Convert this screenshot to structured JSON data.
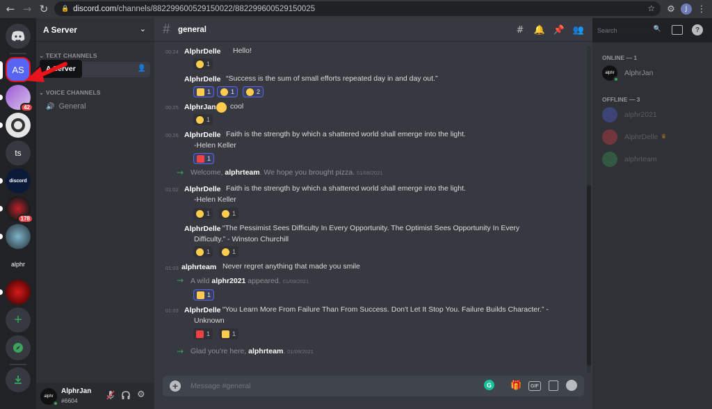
{
  "browser": {
    "url_host": "discord.com",
    "url_path": "/channels/882299600529150022/882299600529150025",
    "profile_initial": "J"
  },
  "rail": {
    "servers": [
      {
        "name": "home",
        "label": ""
      },
      {
        "name": "a-server",
        "label": "AS"
      },
      {
        "name": "server-2",
        "label": "",
        "badge": "42"
      },
      {
        "name": "server-3",
        "label": ""
      },
      {
        "name": "server-ts",
        "label": "ts"
      },
      {
        "name": "server-discord-bio",
        "label": "discord"
      },
      {
        "name": "server-6",
        "label": "",
        "badge": "178"
      },
      {
        "name": "server-7",
        "label": ""
      },
      {
        "name": "server-alphr",
        "label": "alphr"
      },
      {
        "name": "server-9",
        "label": ""
      }
    ],
    "add_label": "+",
    "tooltip": "A Server"
  },
  "sidebar": {
    "server_name": "A Server",
    "text_category": "TEXT CHANNELS",
    "voice_category": "VOICE CHANNELS",
    "voice_channel": "General",
    "user": {
      "name": "AlphrJan",
      "tag": "#6604",
      "avatar_text": "alphr"
    }
  },
  "topbar": {
    "channel": "general",
    "search_placeholder": "Search"
  },
  "messages": [
    {
      "time": "00:24",
      "author": "AlphrDelle",
      "text": "Hello!",
      "reactions": [
        {
          "emoji": "heart-eyes",
          "count": "1"
        }
      ]
    },
    {
      "author": "AlphrDelle",
      "text": "“Success is the sum of small efforts repeated day in and day out.”",
      "reactions": [
        {
          "emoji": "thumbs-up",
          "count": "1"
        },
        {
          "emoji": "grin",
          "count": "1"
        },
        {
          "emoji": "heart-eyes",
          "count": "2"
        }
      ]
    },
    {
      "time": "00:25",
      "author": "AlphrJan",
      "text": "cool",
      "reactions": [
        {
          "emoji": "smile",
          "count": "1"
        }
      ]
    },
    {
      "time": "00:26",
      "author": "AlphrDelle",
      "text": "Faith is the strength by which a shattered world shall emerge into the light.",
      "text2": "-Helen Keller",
      "reactions": [
        {
          "emoji": "100",
          "count": "1"
        }
      ]
    },
    {
      "system": true,
      "pre": "Welcome, ",
      "bold": "alphrteam",
      "post": ". We hope you brought pizza.",
      "date": "01/09/2021"
    },
    {
      "time": "01:02",
      "author": "AlphrDelle",
      "text": "Faith is the strength by which a shattered world shall emerge into the light.",
      "text2": "-Helen Keller",
      "reactions": [
        {
          "emoji": "kiss",
          "count": "1"
        },
        {
          "emoji": "innocent",
          "count": "1"
        }
      ]
    },
    {
      "author": "AlphrDelle",
      "text": "“The Pessimist Sees Difficulty In Every Opportunity. The Optimist Sees Opportunity In Every",
      "text2": "Difficulty.” - Winston Churchill",
      "reactions": [
        {
          "emoji": "heart-eyes",
          "count": "1"
        },
        {
          "emoji": "kiss-heart",
          "count": "1"
        }
      ]
    },
    {
      "time": "01:03",
      "author": "alphrteam",
      "text": "Never regret anything that made you smile"
    },
    {
      "system": true,
      "pre": "A wild ",
      "bold": "alphr2021",
      "post": " appeared.",
      "date": "01/09/2021",
      "reactions": [
        {
          "emoji": "thumbs-up",
          "count": "1"
        }
      ]
    },
    {
      "time": "01:03",
      "author": "AlphrDelle",
      "text": "“You Learn More From Failure Than From Success. Don't Let It Stop You. Failure Builds Character.” -",
      "text2": "Unknown",
      "reactions": [
        {
          "emoji": "100",
          "count": "1"
        },
        {
          "emoji": "rock-on",
          "count": "1"
        }
      ]
    },
    {
      "system": true,
      "pre": "Glad you're here, ",
      "bold": "alphrteam",
      "post": ".",
      "date": "01/09/2021"
    }
  ],
  "composer": {
    "placeholder": "Message #general",
    "gif_label": "GIF"
  },
  "members": {
    "online_header": "ONLINE — 1",
    "offline_header": "OFFLINE — 3",
    "online": [
      {
        "name": "AlphrJan",
        "avatar_text": "alphr"
      }
    ],
    "offline": [
      {
        "name": "alphr2021",
        "color": "#5865f2"
      },
      {
        "name": "AlphrDelle",
        "color": "#ed4245",
        "crown": true
      },
      {
        "name": "alphrteam",
        "color": "#3ba55d"
      }
    ]
  },
  "colors": {
    "brand": "#5865f2",
    "online": "#3ba55d",
    "danger": "#ed4245",
    "highlight_arrow": "#e8131b"
  }
}
